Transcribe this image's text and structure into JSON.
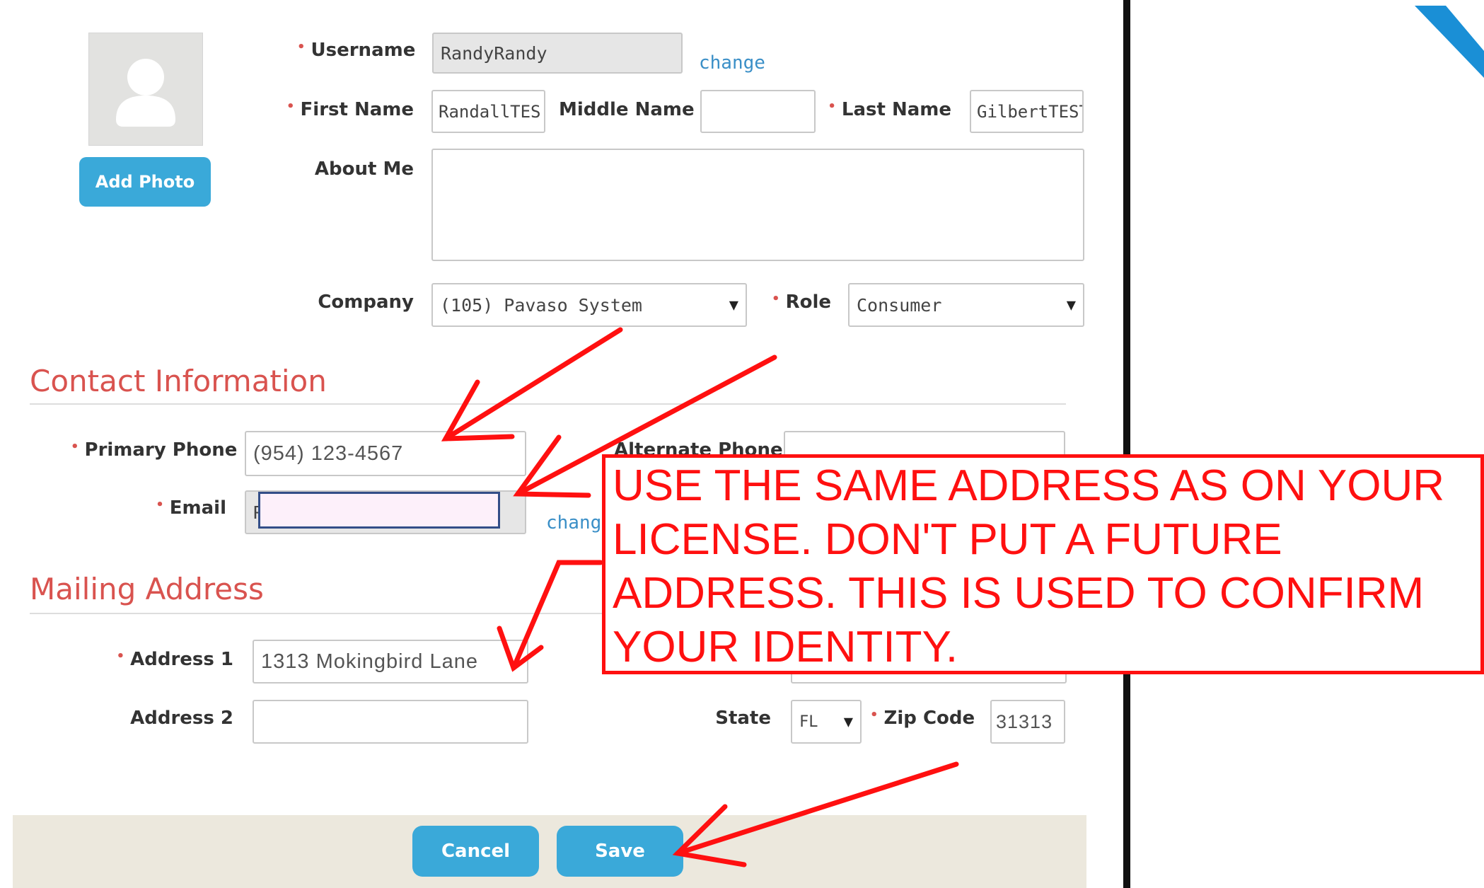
{
  "avatar": {
    "add_photo_label": "Add Photo"
  },
  "profile": {
    "username_label": "Username",
    "username_value": "RandyRandy",
    "username_change": "change",
    "first_name_label": "First Name",
    "first_name_value": "RandallTES",
    "middle_name_label": "Middle Name",
    "middle_name_value": "",
    "last_name_label": "Last Name",
    "last_name_value": "GilbertTEST",
    "about_label": "About Me",
    "about_value": "",
    "company_label": "Company",
    "company_value": "(105) Pavaso System",
    "role_label": "Role",
    "role_value": "Consumer"
  },
  "contact": {
    "title": "Contact Information",
    "primary_phone_label": "Primary Phone",
    "primary_phone_value": "(954) 123-4567",
    "alternate_phone_label": "Alternate Phone",
    "alternate_phone_value": "",
    "email_label": "Email",
    "email_visible_prefix": "R",
    "email_change": "chang"
  },
  "mailing": {
    "title": "Mailing Address",
    "address1_label": "Address 1",
    "address1_value": "1313 Mokingbird Lane",
    "address2_label": "Address 2",
    "address2_value": "",
    "state_label": "State",
    "state_value": "FL",
    "zip_label": "Zip Code",
    "zip_value": "31313"
  },
  "footer": {
    "cancel_label": "Cancel",
    "save_label": "Save"
  },
  "annotation": {
    "text": "USE THE SAME ADDRESS AS ON YOUR LICENSE.  DON'T PUT A FUTURE ADDRESS.  THIS IS USED TO CONFIRM YOUR IDENTITY.",
    "color": "#ff1010"
  },
  "colors": {
    "accent": "#3aa9d9",
    "section": "#d9534f",
    "link": "#3a8fc7",
    "footer": "#ece8dd"
  }
}
